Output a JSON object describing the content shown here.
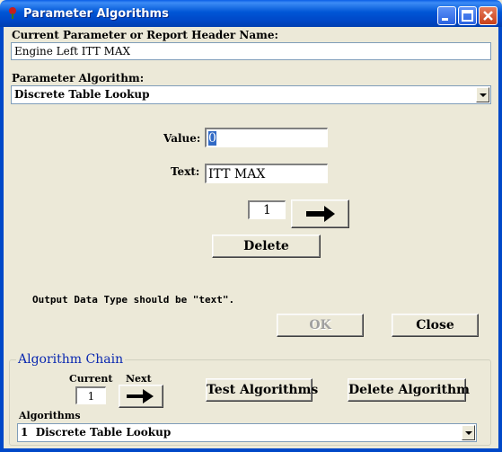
{
  "window": {
    "title": "Parameter Algorithms"
  },
  "header_name": {
    "label": "Current Parameter or Report Header Name:",
    "value": "Engine Left ITT MAX"
  },
  "algorithm": {
    "label": "Parameter Algorithm:",
    "selected": "Discrete Table Lookup"
  },
  "value_field": {
    "label": "Value:",
    "value": "0"
  },
  "text_field": {
    "label": "Text:",
    "value": "ITT MAX"
  },
  "index_box": {
    "value": "1"
  },
  "delete_label": "Delete",
  "output_note": "Output Data Type should be \"text\".",
  "ok_label": "OK",
  "close_label": "Close",
  "chain": {
    "title": "Algorithm Chain",
    "current_label": "Current",
    "next_label": "Next",
    "current_value": "1",
    "test_label": "Test Algorithms",
    "delete_label": "Delete Algorithm",
    "algorithms_label": "Algorithms",
    "algorithms_selected": "1  Discrete Table Lookup"
  }
}
